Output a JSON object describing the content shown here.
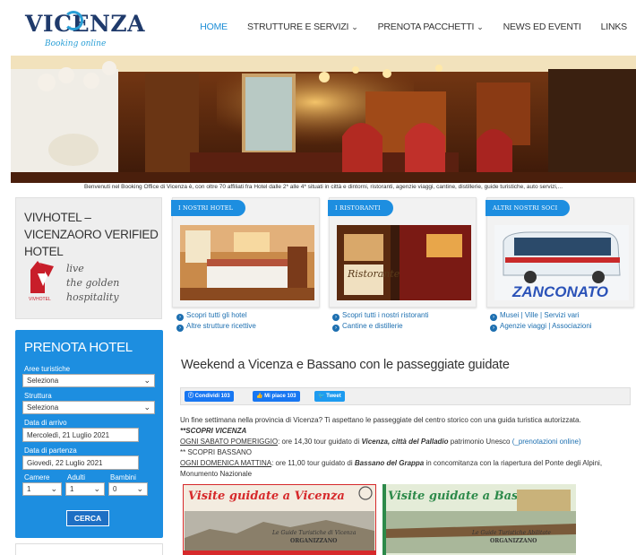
{
  "header": {
    "logo_text": "VICENZA",
    "logo_sub": "Booking online",
    "nav": [
      {
        "label": "HOME",
        "active": true,
        "dropdown": false
      },
      {
        "label": "STRUTTURE E SERVIZI",
        "active": false,
        "dropdown": true
      },
      {
        "label": "PRENOTA PACCHETTI",
        "active": false,
        "dropdown": true
      },
      {
        "label": "NEWS ED EVENTI",
        "active": false,
        "dropdown": false
      },
      {
        "label": "LINKS",
        "active": false,
        "dropdown": false
      }
    ]
  },
  "banner": {
    "caption": "Benvenuti nel Booking Office di Vicenza è, con oltre 70 affiliati fra Hotel dalle 2* alle 4* situati in città e dintorni, ristoranti, agenzie viaggi, cantine, distillerie, guide turistiche, auto servizi,..."
  },
  "vivhotel": {
    "title": "VIVHOTEL – VICENZAORO VERIFIED HOTEL",
    "tagline_lines": [
      "live",
      "the golden",
      "hospitality"
    ],
    "logo_label": "VIVHOTEL"
  },
  "prenota": {
    "title": "PRENOTA HOTEL",
    "aree_label": "Aree turistiche",
    "aree_value": "Seleziona",
    "struttura_label": "Struttura",
    "struttura_value": "Seleziona",
    "arrivo_label": "Data di arrivo",
    "arrivo_value": "Mercoledì, 21 Luglio 2021",
    "partenza_label": "Data di partenza",
    "partenza_value": "Giovedì, 22 Luglio 2021",
    "camere_label": "Camere",
    "camere_value": "1",
    "adulti_label": "Adulti",
    "adulti_value": "1",
    "bambini_label": "Bambini",
    "bambini_value": "0",
    "cerca_label": "CERCA"
  },
  "cards": [
    {
      "tab": "I NOSTRI HOTEL",
      "links": [
        "Scopri tutti gli hotel",
        "Altre strutture ricettive"
      ]
    },
    {
      "tab": "I RISTORANTI",
      "sign": "Ristorante",
      "links": [
        "Scopri tutti i nostri ristoranti",
        "Cantine e distillerie"
      ]
    },
    {
      "tab": "ALTRI NOSTRI SOCI",
      "bus_brand": "ZANCONATO",
      "links": [
        "Musei | Ville | Servizi vari",
        "Agenzie viaggi | Associazioni"
      ]
    }
  ],
  "article": {
    "title": "Weekend a Vicenza e Bassano con le passeggiate guidate",
    "share": {
      "condividi": "Condividi 103",
      "mi_piace": "Mi piace 103",
      "tweet": "Tweet"
    },
    "intro": "Un fine settimana nella provincia di Vicenza? Ti aspettano le passeggiate del centro storico con una guida turistica autorizzata.",
    "vicenza_heading": "**SCOPRI VICENZA",
    "vicenza_when": "OGNI SABATO POMERIGGIO",
    "vicenza_text_a": ": ore 14,30 tour guidato di ",
    "vicenza_bold": "Vicenza, città del Palladio",
    "vicenza_text_b": " patrimonio Unesco  ",
    "vicenza_link": "(_prenotazioni online)",
    "bassano_heading": "** SCOPRI BASSANO",
    "bassano_when": "OGNI DOMENICA MATTINA",
    "bassano_text_a": ": ore 11,00 tour guidato di ",
    "bassano_bold": "Bassano del Grappa",
    "bassano_text_b": " in concomitanza con la riapertura del Ponte degli Alpini,",
    "bassano_text_c": "Monumento Nazionale",
    "poster1_title": "Visite guidate a Vicenza",
    "poster1_sub": "Le Guide Turistiche di Vicenza",
    "poster1_sub2": "ORGANIZZANO",
    "poster2_title": "Visite guidate a Bassano",
    "poster2_sub": "Le Guide Turistiche Abilitate",
    "poster2_sub2": "ORGANIZZANO"
  },
  "colors": {
    "accent": "#1d8ee0",
    "nav_active": "#1e8ed6",
    "link": "#1d6fb0",
    "poster_red": "#d6292b",
    "poster_green": "#2d8a4a"
  }
}
